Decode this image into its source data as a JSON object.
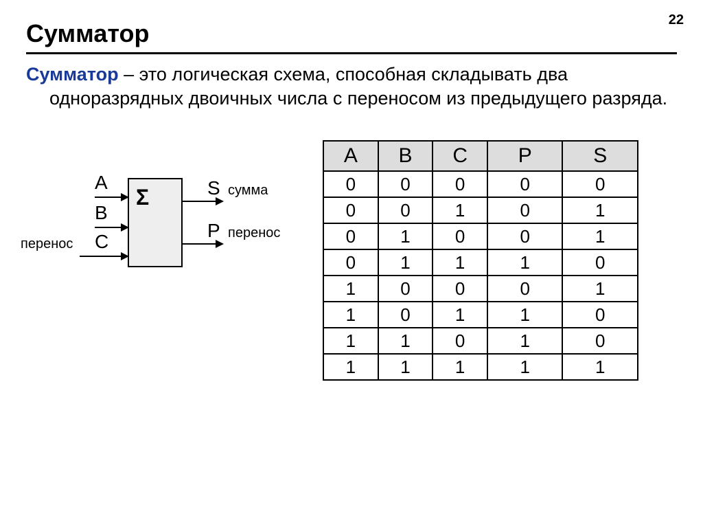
{
  "page_number": "22",
  "title": "Сумматор",
  "definition": {
    "term": "Сумматор",
    "rest": " – это логическая схема, способная складывать два одноразрядных двоичных числа с переносом из предыдущего разряда."
  },
  "diagram": {
    "sigma": "Σ",
    "input_A": "A",
    "input_B": "B",
    "input_C": "C",
    "input_C_label": "перенос",
    "output_S": "S",
    "output_S_label": "сумма",
    "output_P": "P",
    "output_P_label": "перенос"
  },
  "table": {
    "headers": [
      "A",
      "B",
      "C",
      "P",
      "S"
    ],
    "rows": [
      [
        "0",
        "0",
        "0",
        "0",
        "0"
      ],
      [
        "0",
        "0",
        "1",
        "0",
        "1"
      ],
      [
        "0",
        "1",
        "0",
        "0",
        "1"
      ],
      [
        "0",
        "1",
        "1",
        "1",
        "0"
      ],
      [
        "1",
        "0",
        "0",
        "0",
        "1"
      ],
      [
        "1",
        "0",
        "1",
        "1",
        "0"
      ],
      [
        "1",
        "1",
        "0",
        "1",
        "0"
      ],
      [
        "1",
        "1",
        "1",
        "1",
        "1"
      ]
    ]
  }
}
